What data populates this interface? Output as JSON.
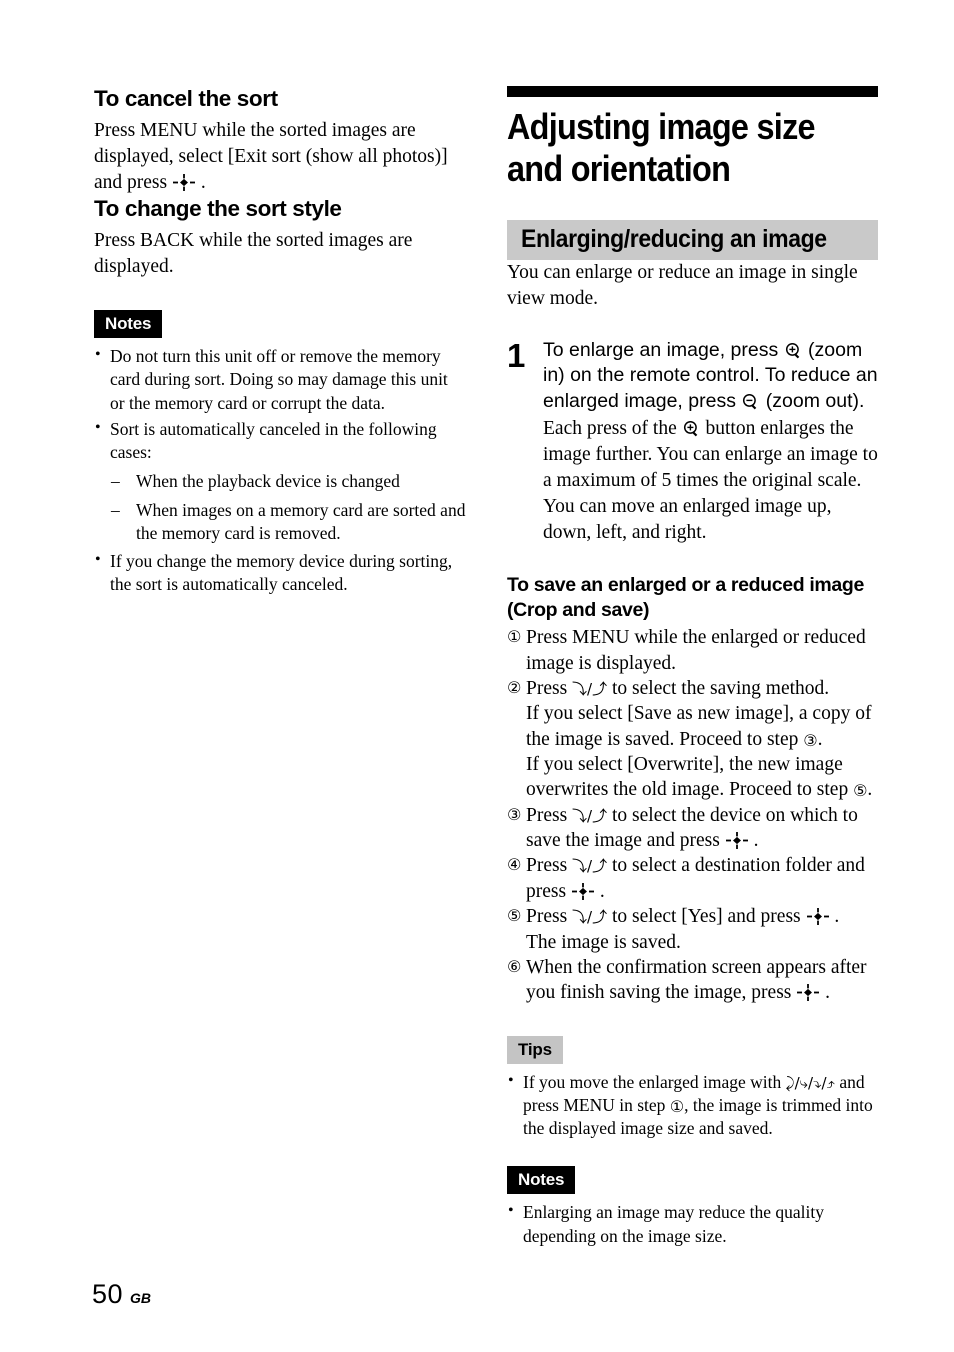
{
  "page": {
    "folio": "50",
    "folio_suffix": "GB"
  },
  "left_column": {
    "section1": {
      "heading": "To cancel the sort",
      "body_parts": {
        "a": "Press MENU while the sorted images are displayed, select [Exit sort (show all photos)] and press ",
        "b": " ."
      }
    },
    "section2": {
      "heading": "To change the sort style",
      "body": "Press BACK while the sorted images are displayed."
    },
    "notes": {
      "badge": "Notes",
      "items": [
        "Do not turn this unit off or remove the memory card during sort. Doing so may damage this unit or the memory card or corrupt the data.",
        "Sort is automatically canceled in the following cases:",
        "If you change the memory device during sorting, the sort is automatically canceled."
      ],
      "sub_items": [
        "When the playback device is changed",
        "When images on a memory card are sorted and the memory card is removed."
      ]
    }
  },
  "right_column": {
    "chapter_title": "Adjusting image size\nand orientation",
    "band_title": "Enlarging/reducing an image",
    "band_intro": "You can enlarge or reduce an image in single view mode.",
    "step1": {
      "number": "1",
      "lead_parts": {
        "a": "To enlarge an image, press ",
        "b": " (zoom in) on the remote control. To reduce an enlarged image, press ",
        "c": " (zoom out)."
      },
      "detail_parts": {
        "a": "Each press of the ",
        "b": " button enlarges the image further. You can enlarge an image to a maximum of 5 times the original scale. You can move an enlarged image up, down, left, and right."
      }
    },
    "crop_save": {
      "heading": "To save an enlarged or a reduced image\n(Crop and save)",
      "steps": [
        {
          "mark": "①",
          "text": "Press MENU while the enlarged or reduced image is displayed.",
          "continuations": []
        },
        {
          "mark": "②",
          "text_parts": {
            "a": "Press ",
            "b": " to select the saving method."
          },
          "continuations": [
            {
              "a": "If you select [Save as new image], a copy of the image is saved. Proceed to step ",
              "mark": "③",
              "b": "."
            },
            {
              "a": "If you select [Overwrite], the new image overwrites the old image. Proceed to step ",
              "mark": "⑤",
              "b": "."
            }
          ]
        },
        {
          "mark": "③",
          "text_parts": {
            "a": "Press ",
            "b": " to select the device on which to save the image and press ",
            "c": " ."
          },
          "continuations": []
        },
        {
          "mark": "④",
          "text_parts": {
            "a": "Press ",
            "b": " to select a destination folder and press ",
            "c": " ."
          },
          "continuations": []
        },
        {
          "mark": "⑤",
          "text_parts": {
            "a": "Press ",
            "b": " to select [Yes] and press ",
            "c": " ."
          },
          "continuations": [
            {
              "a": "The image is saved.",
              "mark": "",
              "b": ""
            }
          ]
        },
        {
          "mark": "⑥",
          "text_parts": {
            "a": "When the confirmation screen appears after you finish saving the image, press ",
            "b": "",
            "c": " ."
          },
          "continuations": []
        }
      ]
    },
    "tips": {
      "badge": "Tips",
      "item_parts": {
        "a": "If you move the enlarged image with ",
        "b": " and press MENU in step ",
        "mark": "①",
        "c": ", the image is trimmed into the displayed image size and saved."
      }
    },
    "notes": {
      "badge": "Notes",
      "items": [
        "Enlarging an image may reduce the quality depending on the image size."
      ]
    }
  },
  "icons": {
    "enter": "enter-dpad-icon",
    "zoom_in": "zoom-in-magnifier-icon",
    "zoom_out": "zoom-out-magnifier-icon",
    "arrow_down_up": "↓/↑",
    "arrow_four": "←/→/↓/↑"
  },
  "colors": {
    "band_gray": "#c9c9c9",
    "badge_tips_gray": "#c4c4c4",
    "badge_notes_black": "#000000",
    "text": "#000000",
    "page_bg": "#ffffff"
  }
}
